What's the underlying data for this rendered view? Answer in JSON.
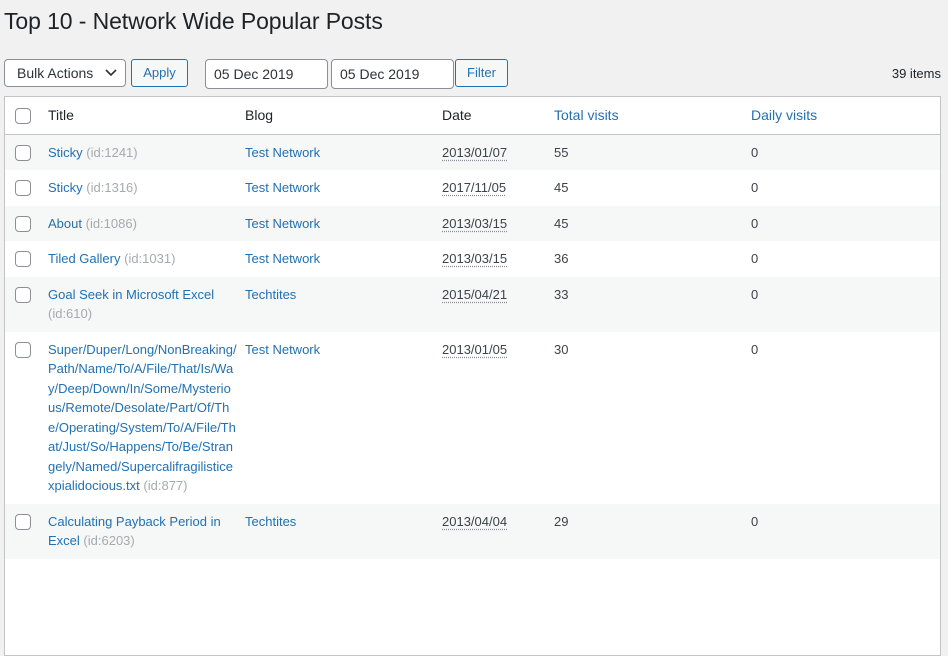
{
  "page": {
    "title": "Top 10 - Network Wide Popular Posts"
  },
  "toolbar": {
    "bulk_actions": "Bulk Actions",
    "apply": "Apply",
    "date_from": "05 Dec 2019",
    "date_to": "05 Dec 2019",
    "filter": "Filter",
    "items_count": "39 items"
  },
  "table": {
    "columns": {
      "title": "Title",
      "blog": "Blog",
      "date": "Date",
      "total_visits": "Total visits",
      "daily_visits": "Daily visits"
    },
    "rows": [
      {
        "title": "Sticky",
        "id": "(id:1241)",
        "blog": "Test Network",
        "date": "2013/01/07",
        "total": "55",
        "daily": "0"
      },
      {
        "title": "Sticky",
        "id": "(id:1316)",
        "blog": "Test Network",
        "date": "2017/11/05",
        "total": "45",
        "daily": "0"
      },
      {
        "title": "About",
        "id": "(id:1086)",
        "blog": "Test Network",
        "date": "2013/03/15",
        "total": "45",
        "daily": "0"
      },
      {
        "title": "Tiled Gallery",
        "id": "(id:1031)",
        "blog": "Test Network",
        "date": "2013/03/15",
        "total": "36",
        "daily": "0"
      },
      {
        "title": "Goal Seek in Microsoft Excel",
        "id": "(id:610)",
        "blog": "Techtites",
        "date": "2015/04/21",
        "total": "33",
        "daily": "0"
      },
      {
        "title": "Super/Duper/Long/NonBreaking/Path/Name/To/A/File/That/Is/Way/Deep/Down/In/Some/Mysterious/Remote/Desolate/Part/Of/The/Operating/System/To/A/File/That/Just/So/Happens/To/Be/Strangely/Named/Supercalifragilisticexpialidocious.txt",
        "id": "(id:877)",
        "blog": "Test Network",
        "date": "2013/01/05",
        "total": "30",
        "daily": "0"
      },
      {
        "title": "Calculating Payback Period in Excel",
        "id": "(id:6203)",
        "blog": "Techtites",
        "date": "2013/04/04",
        "total": "29",
        "daily": "0"
      }
    ]
  },
  "icons": {
    "bulk_chevron": "chevron-down-icon",
    "checkbox": "checkbox-icon"
  },
  "colors": {
    "link": "#2271b1",
    "background": "#f1f1f1",
    "alt_row": "#f6f7f7"
  }
}
